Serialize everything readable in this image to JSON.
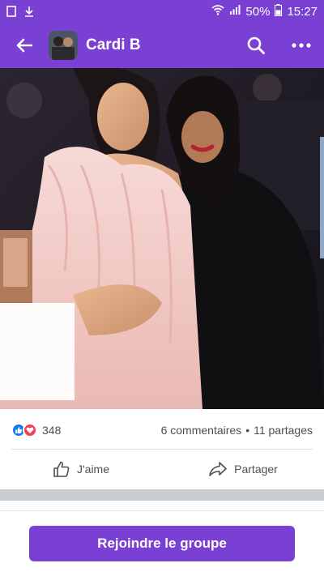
{
  "status_bar": {
    "battery": "50%",
    "time": "15:27"
  },
  "app_bar": {
    "title": "Cardi B"
  },
  "post": {
    "reaction_count": "348",
    "comments": "6 commentaires",
    "separator_dot": "•",
    "shares": "11 partages",
    "like_label": "J'aime",
    "share_label": "Partager"
  },
  "join": {
    "label": "Rejoindre le groupe"
  },
  "colors": {
    "brand": "#7a3fd3",
    "like": "#1877f2",
    "love": "#f33e58"
  }
}
